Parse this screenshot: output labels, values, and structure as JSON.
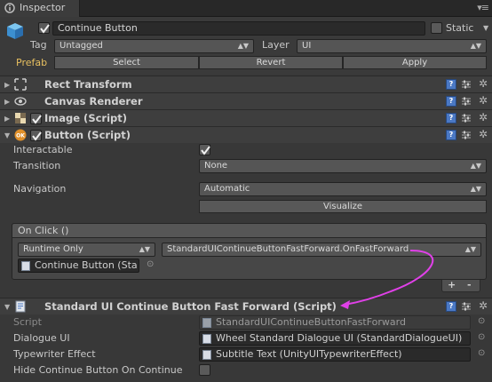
{
  "tab": {
    "title": "Inspector"
  },
  "header": {
    "object_name": "Continue Button",
    "active": true,
    "static_label": "Static",
    "static": false,
    "tag_label": "Tag",
    "tag_value": "Untagged",
    "layer_label": "Layer",
    "layer_value": "UI",
    "prefab_label": "Prefab",
    "prefab_select": "Select",
    "prefab_revert": "Revert",
    "prefab_apply": "Apply"
  },
  "components": {
    "rect_transform": "Rect Transform",
    "canvas_renderer": "Canvas Renderer",
    "image": "Image (Script)",
    "button": "Button (Script)"
  },
  "button": {
    "interactable_label": "Interactable",
    "interactable": true,
    "transition_label": "Transition",
    "transition_value": "None",
    "navigation_label": "Navigation",
    "navigation_value": "Automatic",
    "visualize_label": "Visualize",
    "onclick_label": "On Click ()",
    "runtime_value": "Runtime Only",
    "function_value": "StandardUIContinueButtonFastForward.OnFastForward",
    "object_value": "Continue Button (Sta",
    "plus": "+",
    "minus": "-"
  },
  "fastforward": {
    "title": "Standard UI Continue Button Fast Forward (Script)",
    "script_label": "Script",
    "script_value": "StandardUIContinueButtonFastForward",
    "dialogue_label": "Dialogue UI",
    "dialogue_value": "Wheel Standard Dialogue UI (StandardDialogueUI)",
    "typewriter_label": "Typewriter Effect",
    "typewriter_value": "Subtitle Text (UnityUITypewriterEffect)",
    "hide_label": "Hide Continue Button On Continue",
    "hide_value": false
  },
  "colors": {
    "prefab_label": "#e8c060",
    "annotation_arrow": "#e040e8",
    "help_icon": "#4a78c4"
  },
  "icons": [
    "inspector-icon",
    "gameobject-cube-icon",
    "rect-transform-icon",
    "eye-icon",
    "image-icon",
    "button-ok-icon",
    "script-icon",
    "help-icon",
    "sliders-icon",
    "gear-icon",
    "object-picker-icon"
  ]
}
